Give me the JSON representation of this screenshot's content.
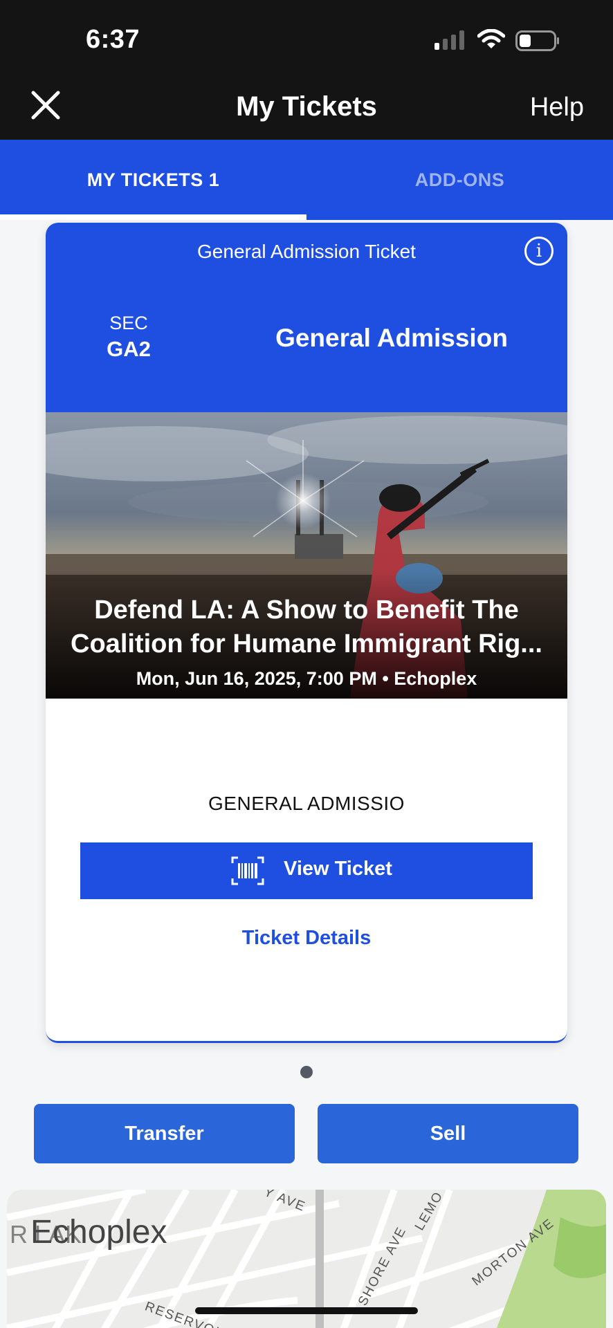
{
  "status_bar": {
    "time": "6:37"
  },
  "nav": {
    "title": "My Tickets",
    "help": "Help"
  },
  "tabs": [
    {
      "label": "MY TICKETS 1"
    },
    {
      "label": "ADD-ONS"
    }
  ],
  "ticket": {
    "type": "General Admission Ticket",
    "sec_label": "SEC",
    "sec_value": "GA2",
    "area": "General Admission",
    "event_title": "Defend LA: A Show to Benefit The Coalition for Humane Immigrant Rig...",
    "event_date": "Mon, Jun 16, 2025, 7:00 PM • Echoplex",
    "admission_text": "GENERAL ADMISSIO",
    "view_ticket": "View Ticket",
    "ticket_details": "Ticket Details"
  },
  "actions": {
    "transfer": "Transfer",
    "sell": "Sell"
  },
  "map": {
    "venue": "Echoplex",
    "ghost_label": "R LAK",
    "streets": [
      "Y AVE",
      "LEMO",
      "SHORE AVE",
      "MORTON AVE",
      "RESERVOIR",
      "AKE SHORE AVE"
    ]
  },
  "colors": {
    "brand_blue": "#1f4fe0",
    "action_blue": "#2a66d9",
    "dark": "#141414"
  },
  "icons": [
    "close-icon",
    "info-icon",
    "barcode-icon",
    "signal-icon",
    "wifi-icon",
    "battery-icon"
  ]
}
